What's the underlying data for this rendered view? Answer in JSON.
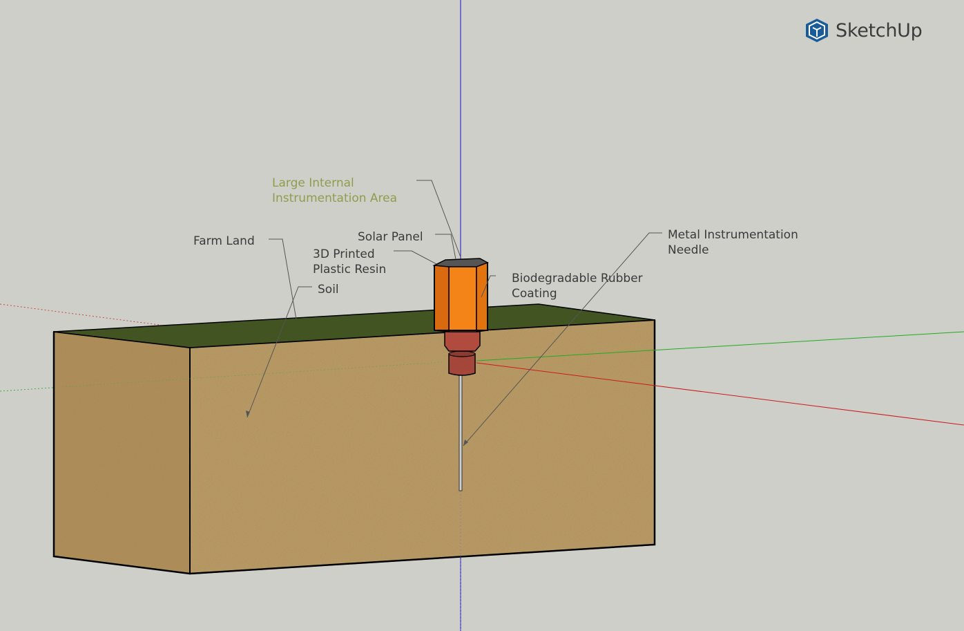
{
  "app": {
    "brand": "SketchUp",
    "logo_icon": "sketchup-logo-icon",
    "brand_color": "#1a5b9a"
  },
  "colors": {
    "background": "#cfcfc9",
    "soil": "#b99a63",
    "grass": "#435423",
    "housing_orange": "#ef7a16",
    "rubber_coating": "#a5463a",
    "axis_blue": "#1010c8",
    "axis_red": "#cc1a1a",
    "axis_green": "#22aa22",
    "highlight_label": "#8f9c4e"
  },
  "labels": {
    "internal_area": [
      "Large Internal",
      "Instrumentation Area"
    ],
    "solar_panel": "Solar Panel",
    "plastic_resin": [
      "3D Printed",
      "Plastic Resin"
    ],
    "farm_land": "Farm Land",
    "soil": "Soil",
    "rubber_coating": [
      "Biodegradable Rubber",
      "Coating"
    ],
    "needle": [
      "Metal Instrumentation",
      "Needle"
    ]
  }
}
